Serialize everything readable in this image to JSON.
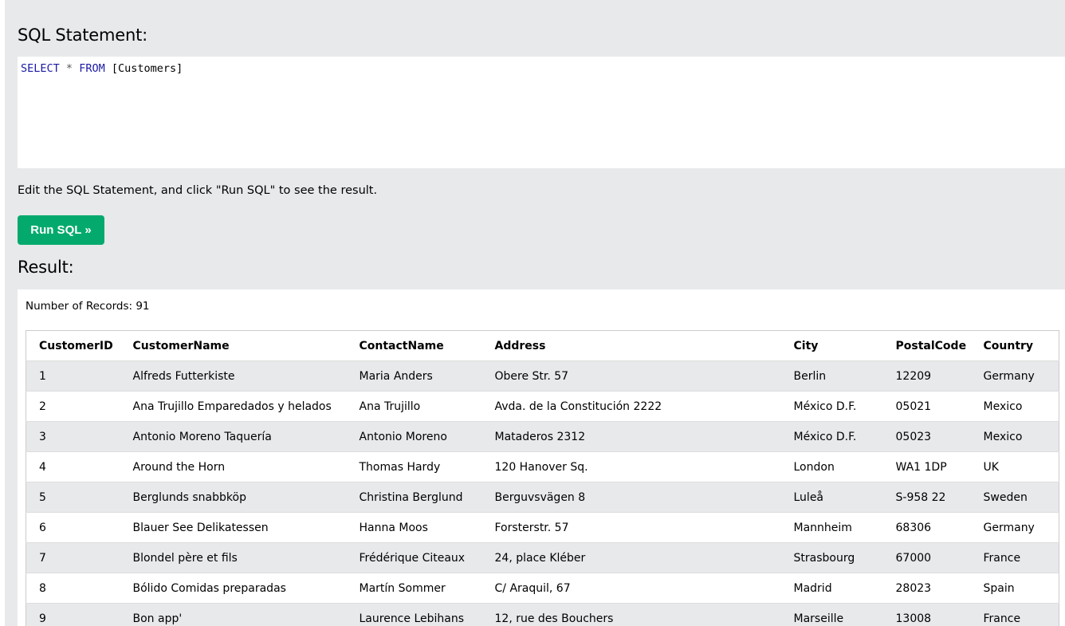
{
  "editor": {
    "heading": "SQL Statement:",
    "keyword_select": "SELECT",
    "star": "*",
    "keyword_from": "FROM",
    "table_ref": "[Customers]"
  },
  "hint_text": "Edit the SQL Statement, and click \"Run SQL\" to see the result.",
  "run_button": {
    "label": "Run SQL",
    "arrow": "»"
  },
  "result": {
    "heading": "Result:",
    "records_label": "Number of Records: 91",
    "columns": [
      "CustomerID",
      "CustomerName",
      "ContactName",
      "Address",
      "City",
      "PostalCode",
      "Country"
    ],
    "rows": [
      [
        "1",
        "Alfreds Futterkiste",
        "Maria Anders",
        "Obere Str. 57",
        "Berlin",
        "12209",
        "Germany"
      ],
      [
        "2",
        "Ana Trujillo Emparedados y helados",
        "Ana Trujillo",
        "Avda. de la Constitución 2222",
        "México D.F.",
        "05021",
        "Mexico"
      ],
      [
        "3",
        "Antonio Moreno Taquería",
        "Antonio Moreno",
        "Mataderos 2312",
        "México D.F.",
        "05023",
        "Mexico"
      ],
      [
        "4",
        "Around the Horn",
        "Thomas Hardy",
        "120 Hanover Sq.",
        "London",
        "WA1 1DP",
        "UK"
      ],
      [
        "5",
        "Berglunds snabbköp",
        "Christina Berglund",
        "Berguvsvägen 8",
        "Luleå",
        "S-958 22",
        "Sweden"
      ],
      [
        "6",
        "Blauer See Delikatessen",
        "Hanna Moos",
        "Forsterstr. 57",
        "Mannheim",
        "68306",
        "Germany"
      ],
      [
        "7",
        "Blondel père et fils",
        "Frédérique Citeaux",
        "24, place Kléber",
        "Strasbourg",
        "67000",
        "France"
      ],
      [
        "8",
        "Bólido Comidas preparadas",
        "Martín Sommer",
        "C/ Araquil, 67",
        "Madrid",
        "28023",
        "Spain"
      ],
      [
        "9",
        "Bon app'",
        "Laurence Lebihans",
        "12, rue des Bouchers",
        "Marseille",
        "13008",
        "France"
      ]
    ]
  }
}
